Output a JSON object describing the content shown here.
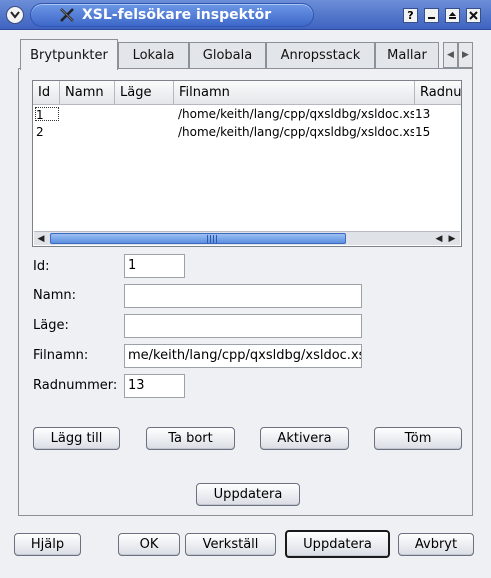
{
  "window": {
    "title": "XSL-felsökare inspektör",
    "controls": {
      "help": "?"
    }
  },
  "tabs": [
    {
      "label": "Brytpunkter",
      "active": true
    },
    {
      "label": "Lokala"
    },
    {
      "label": "Globala"
    },
    {
      "label": "Anropsstack"
    },
    {
      "label": "Mallar"
    }
  ],
  "breakpoints": {
    "columns": [
      "Id",
      "Namn",
      "Läge",
      "Filnamn",
      "Radnu"
    ],
    "rows": [
      {
        "id": "1",
        "name": "",
        "mode": "",
        "file": "/home/keith/lang/cpp/qxsldbg/xsldoc.xsl",
        "line": "13"
      },
      {
        "id": "2",
        "name": "",
        "mode": "",
        "file": "/home/keith/lang/cpp/qxsldbg/xsldoc.xsl",
        "line": "15"
      }
    ]
  },
  "form": {
    "id_label": "Id:",
    "id_value": "1",
    "name_label": "Namn:",
    "name_value": "",
    "mode_label": "Läge:",
    "mode_value": "",
    "file_label": "Filnamn:",
    "file_value": "me/keith/lang/cpp/qxsldbg/xsldoc.xsl",
    "line_label": "Radnummer:",
    "line_value": "13"
  },
  "actions": {
    "add": "Lägg till",
    "remove": "Ta bort",
    "enable": "Aktivera",
    "clear": "Töm",
    "refresh": "Uppdatera"
  },
  "dialog_buttons": {
    "help": "Hjälp",
    "ok": "OK",
    "apply": "Verkställ",
    "refresh": "Uppdatera",
    "cancel": "Avbryt"
  }
}
